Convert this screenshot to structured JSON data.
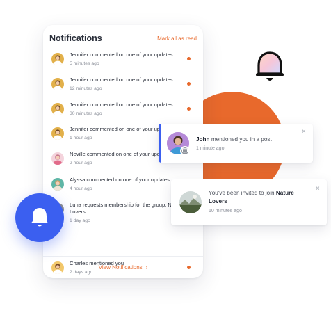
{
  "panel": {
    "title": "Notifications",
    "mark_all_label": "Mark all as read",
    "items": [
      {
        "message": "Jennifer commented on one of your updates",
        "time": "5 minutes ago",
        "unread": true
      },
      {
        "message": "Jennifer commented on one of your updates",
        "time": "12 minutes ago",
        "unread": true
      },
      {
        "message": "Jennifer commented on one of your updates",
        "time": "30 minutes ago",
        "unread": true
      },
      {
        "message": "Jennifer commented on one of your updates",
        "time": "1 hour ago",
        "unread": true
      },
      {
        "message": "Neville commented on one of your updates",
        "time": "2 hour ago",
        "unread": true
      },
      {
        "message": "Alyssa commented on one of your updates",
        "time": "4 hour ago",
        "unread": true
      },
      {
        "message": "Luna requests membership for the group: Nature Lovers",
        "time": "1 day ago",
        "unread": false
      },
      {
        "message": "Charles mentioned you",
        "time": "2 days ago",
        "unread": true
      }
    ],
    "footer_link": "View Notifications",
    "footer_chevron": "›"
  },
  "cards": {
    "mention": {
      "name": "John",
      "message": "mentioned you in a post",
      "time": "1 minute ago",
      "close": "×"
    },
    "invite": {
      "message": "You've been invited to join",
      "group": "Nature Lovers",
      "time": "10 minutes ago",
      "close": "×"
    }
  },
  "colors": {
    "accent_orange": "#e8692c",
    "accent_blue": "#3b5ff0"
  },
  "icons": {
    "decorative_bell": "bell-icon",
    "floating_bell": "bell-icon",
    "mention_badge": "chat-icon"
  }
}
